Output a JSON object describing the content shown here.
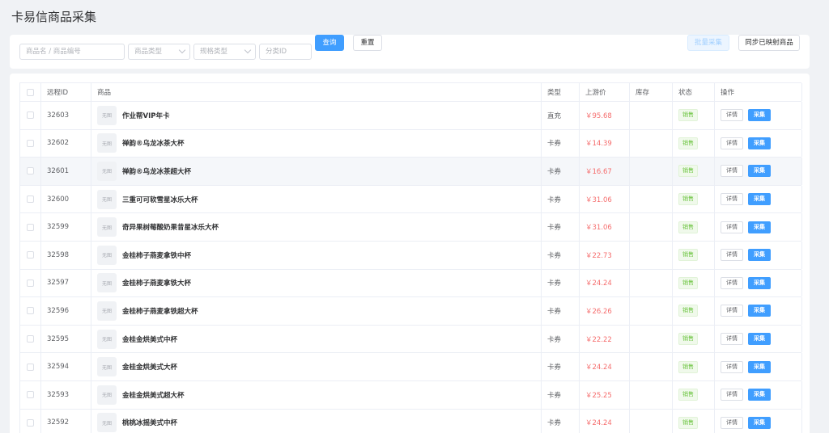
{
  "page": {
    "title": "卡易信商品采集"
  },
  "filters": {
    "keyword_placeholder": "商品名 / 商品编号",
    "product_type_placeholder": "商品类型",
    "spec_type_placeholder": "规格类型",
    "category_placeholder": "分类ID",
    "query_label": "查询",
    "reset_label": "重置",
    "batch_collect_label": "批量采集",
    "sync_label": "同步已映射商品"
  },
  "table": {
    "columns": {
      "remote_id": "远程ID",
      "product": "商品",
      "type": "类型",
      "price": "上游价",
      "stock": "库存",
      "status": "状态",
      "ops": "操作"
    },
    "thumb_text": "无图",
    "detail_label": "详情",
    "collect_label": "采集",
    "rows": [
      {
        "id": "32603",
        "name": "作业帮VIP年卡",
        "type": "直充",
        "price": "￥95.68",
        "stock": "",
        "status": "销售"
      },
      {
        "id": "32602",
        "name": "禅韵®乌龙冰茶大杯",
        "type": "卡券",
        "price": "￥14.39",
        "stock": "",
        "status": "销售"
      },
      {
        "id": "32601",
        "name": "禅韵®乌龙冰茶超大杯",
        "type": "卡券",
        "price": "￥16.67",
        "stock": "",
        "status": "销售"
      },
      {
        "id": "32600",
        "name": "三重可可软雪星冰乐大杯",
        "type": "卡券",
        "price": "￥31.06",
        "stock": "",
        "status": "销售"
      },
      {
        "id": "32599",
        "name": "奇异果树莓酸奶果昔星冰乐大杯",
        "type": "卡券",
        "price": "￥31.06",
        "stock": "",
        "status": "销售"
      },
      {
        "id": "32598",
        "name": "金桂柿子燕麦拿铁中杯",
        "type": "卡券",
        "price": "￥22.73",
        "stock": "",
        "status": "销售"
      },
      {
        "id": "32597",
        "name": "金桂柿子燕麦拿铁大杯",
        "type": "卡券",
        "price": "￥24.24",
        "stock": "",
        "status": "销售"
      },
      {
        "id": "32596",
        "name": "金桂柿子燕麦拿铁超大杯",
        "type": "卡券",
        "price": "￥26.26",
        "stock": "",
        "status": "销售"
      },
      {
        "id": "32595",
        "name": "金桂金烘美式中杯",
        "type": "卡券",
        "price": "￥22.22",
        "stock": "",
        "status": "销售"
      },
      {
        "id": "32594",
        "name": "金桂金烘美式大杯",
        "type": "卡券",
        "price": "￥24.24",
        "stock": "",
        "status": "销售"
      },
      {
        "id": "32593",
        "name": "金桂金烘美式超大杯",
        "type": "卡券",
        "price": "￥25.25",
        "stock": "",
        "status": "销售"
      },
      {
        "id": "32592",
        "name": "桃桃冰摇美式中杯",
        "type": "卡券",
        "price": "￥24.24",
        "stock": "",
        "status": "销售"
      }
    ]
  },
  "colors": {
    "primary": "#409eff",
    "price": "#f56c6c",
    "status": "#67c23a"
  }
}
